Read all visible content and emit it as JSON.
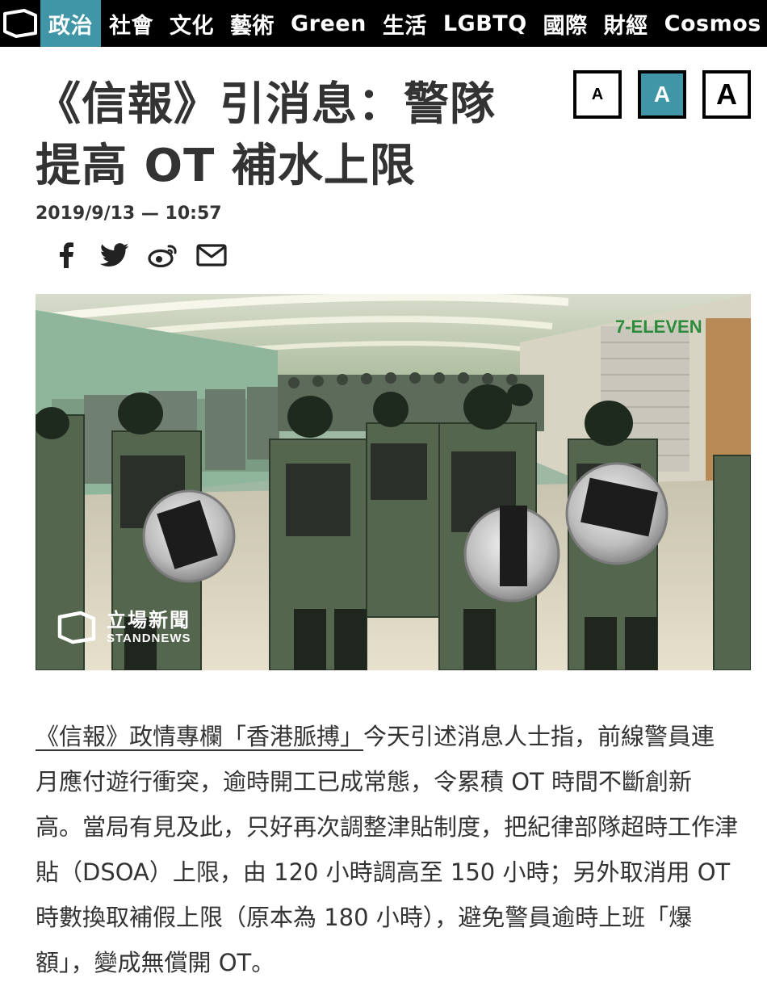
{
  "nav": {
    "logo_icon": "standnews-logo-icon",
    "items": [
      {
        "label": "政治",
        "active": true
      },
      {
        "label": "社會",
        "active": false
      },
      {
        "label": "文化",
        "active": false
      },
      {
        "label": "藝術",
        "active": false
      },
      {
        "label": "Green",
        "active": false
      },
      {
        "label": "生活",
        "active": false
      },
      {
        "label": "LGBTQ",
        "active": false
      },
      {
        "label": "國際",
        "active": false
      },
      {
        "label": "財經",
        "active": false
      },
      {
        "label": "Cosmos",
        "active": false
      }
    ]
  },
  "article": {
    "title_line1": "《信報》引消息：警隊",
    "title_line2": "提高 OT 補水上限",
    "date": "2019/9/13 — 10:57",
    "font_size_buttons": [
      "A",
      "A",
      "A"
    ],
    "share_icons": [
      "facebook-icon",
      "twitter-icon",
      "weibo-icon",
      "email-icon"
    ],
    "photo": {
      "watermark_cn": "立場新聞",
      "watermark_en": "STANDNEWS",
      "sign_text": "7-ELEVEN"
    },
    "body_link": "《信報》政情專欄「香港脈搏」",
    "body_text": "今天引述消息人士指，前線警員連月應付遊行衝突，逾時開工已成常態，令累積 OT 時間不斷創新高。當局有見及此，只好再次調整津貼制度，把紀律部隊超時工作津貼（DSOA）上限，由 120 小時調高至 150 小時；另外取消用 OT 時數換取補假上限（原本為 180 小時），避免警員逾時上班「爆額」，變成無償開 OT。"
  },
  "colors": {
    "accent": "#4096a6",
    "nav_bg": "#000000",
    "text": "#333333"
  }
}
